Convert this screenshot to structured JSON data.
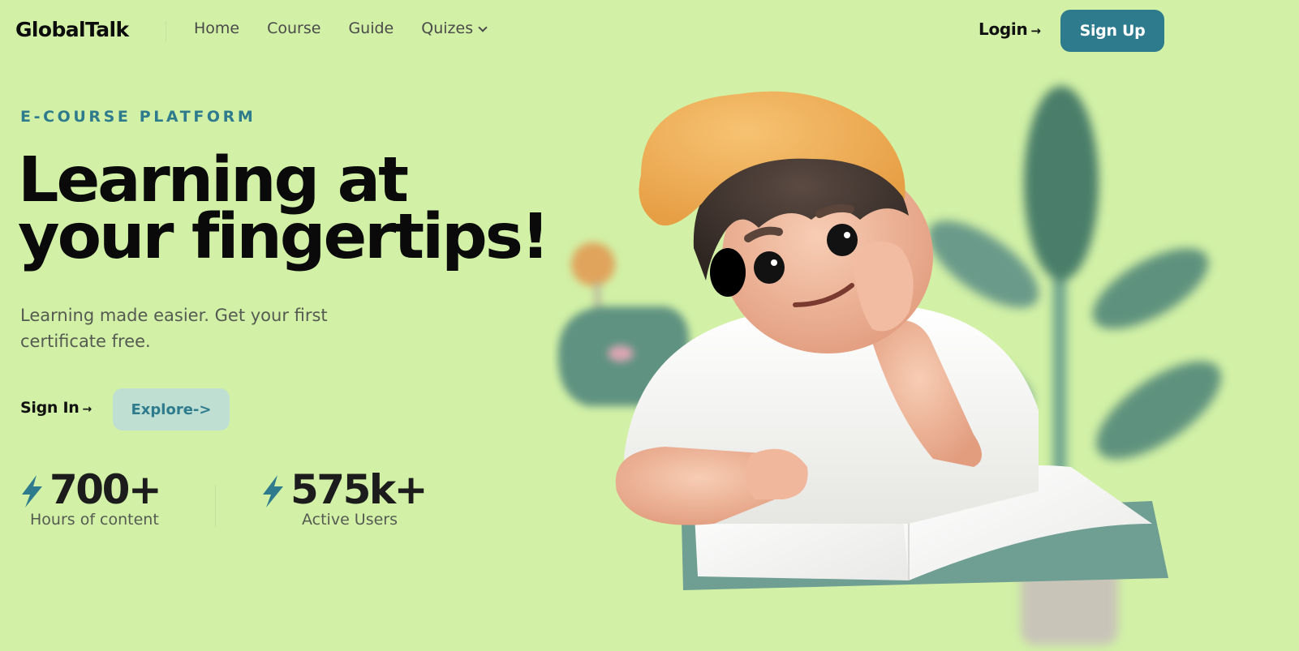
{
  "nav": {
    "logo": "GlobalTalk",
    "links": [
      {
        "label": "Home"
      },
      {
        "label": "Course"
      },
      {
        "label": "Guide"
      },
      {
        "label": "Quizes"
      }
    ],
    "login_label": "Login",
    "login_arrow": "→",
    "signup_label": "Sign Up"
  },
  "hero": {
    "eyebrow": "E-COURSE PLATFORM",
    "headline_line1": "Learning at",
    "headline_line2": "your fingertips!",
    "subtext": "Learning made easier. Get your first certificate free.",
    "signin_label": "Sign In",
    "signin_arrow": "→",
    "explore_label": "Explore->"
  },
  "stats": [
    {
      "value": "700+",
      "label": "Hours of content"
    },
    {
      "value": "575k+",
      "label": "Active Users"
    }
  ],
  "colors": {
    "background": "#d2f1a6",
    "accent": "#2f7b8e",
    "explore_bg": "#bfdfd3",
    "text_dark": "#0a0a0a",
    "text_muted": "#555a52"
  },
  "icons": {
    "stat_icon": "lightning-bolt-icon",
    "dropdown_icon": "chevron-down-icon",
    "arrow_icon": "arrow-right-icon"
  }
}
